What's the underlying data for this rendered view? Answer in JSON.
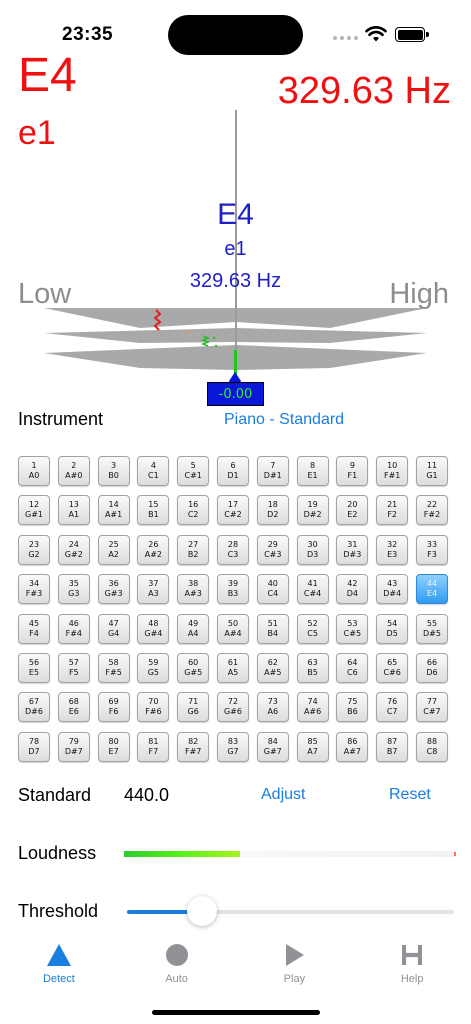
{
  "status_bar": {
    "time": "23:35"
  },
  "readout": {
    "note": "E4",
    "solfege": "e1",
    "frequency": "329.63 Hz"
  },
  "tuner": {
    "note": "E4",
    "solfege": "e1",
    "frequency": "329.63 Hz",
    "low_label": "Low",
    "high_label": "High",
    "cents": "-0.00"
  },
  "instrument": {
    "label": "Instrument",
    "value": "Piano - Standard"
  },
  "keys": [
    {
      "n": "1",
      "name": "A0"
    },
    {
      "n": "2",
      "name": "A#0"
    },
    {
      "n": "3",
      "name": "B0"
    },
    {
      "n": "4",
      "name": "C1"
    },
    {
      "n": "5",
      "name": "C#1"
    },
    {
      "n": "6",
      "name": "D1"
    },
    {
      "n": "7",
      "name": "D#1"
    },
    {
      "n": "8",
      "name": "E1"
    },
    {
      "n": "9",
      "name": "F1"
    },
    {
      "n": "10",
      "name": "F#1"
    },
    {
      "n": "11",
      "name": "G1"
    },
    {
      "n": "12",
      "name": "G#1"
    },
    {
      "n": "13",
      "name": "A1"
    },
    {
      "n": "14",
      "name": "A#1"
    },
    {
      "n": "15",
      "name": "B1"
    },
    {
      "n": "16",
      "name": "C2"
    },
    {
      "n": "17",
      "name": "C#2"
    },
    {
      "n": "18",
      "name": "D2"
    },
    {
      "n": "19",
      "name": "D#2"
    },
    {
      "n": "20",
      "name": "E2"
    },
    {
      "n": "21",
      "name": "F2"
    },
    {
      "n": "22",
      "name": "F#2"
    },
    {
      "n": "23",
      "name": "G2"
    },
    {
      "n": "24",
      "name": "G#2"
    },
    {
      "n": "25",
      "name": "A2"
    },
    {
      "n": "26",
      "name": "A#2"
    },
    {
      "n": "27",
      "name": "B2"
    },
    {
      "n": "28",
      "name": "C3"
    },
    {
      "n": "29",
      "name": "C#3"
    },
    {
      "n": "30",
      "name": "D3"
    },
    {
      "n": "31",
      "name": "D#3"
    },
    {
      "n": "32",
      "name": "E3"
    },
    {
      "n": "33",
      "name": "F3"
    },
    {
      "n": "34",
      "name": "F#3"
    },
    {
      "n": "35",
      "name": "G3"
    },
    {
      "n": "36",
      "name": "G#3"
    },
    {
      "n": "37",
      "name": "A3"
    },
    {
      "n": "38",
      "name": "A#3"
    },
    {
      "n": "39",
      "name": "B3"
    },
    {
      "n": "40",
      "name": "C4"
    },
    {
      "n": "41",
      "name": "C#4"
    },
    {
      "n": "42",
      "name": "D4"
    },
    {
      "n": "43",
      "name": "D#4"
    },
    {
      "n": "44",
      "name": "E4",
      "active": true
    },
    {
      "n": "45",
      "name": "F4"
    },
    {
      "n": "46",
      "name": "F#4"
    },
    {
      "n": "47",
      "name": "G4"
    },
    {
      "n": "48",
      "name": "G#4"
    },
    {
      "n": "49",
      "name": "A4"
    },
    {
      "n": "50",
      "name": "A#4"
    },
    {
      "n": "51",
      "name": "B4"
    },
    {
      "n": "52",
      "name": "C5"
    },
    {
      "n": "53",
      "name": "C#5"
    },
    {
      "n": "54",
      "name": "D5"
    },
    {
      "n": "55",
      "name": "D#5"
    },
    {
      "n": "56",
      "name": "E5"
    },
    {
      "n": "57",
      "name": "F5"
    },
    {
      "n": "58",
      "name": "F#5"
    },
    {
      "n": "59",
      "name": "G5"
    },
    {
      "n": "60",
      "name": "G#5"
    },
    {
      "n": "61",
      "name": "A5"
    },
    {
      "n": "62",
      "name": "A#5"
    },
    {
      "n": "63",
      "name": "B5"
    },
    {
      "n": "64",
      "name": "C6"
    },
    {
      "n": "65",
      "name": "C#6"
    },
    {
      "n": "66",
      "name": "D6"
    },
    {
      "n": "67",
      "name": "D#6"
    },
    {
      "n": "68",
      "name": "E6"
    },
    {
      "n": "69",
      "name": "F6"
    },
    {
      "n": "70",
      "name": "F#6"
    },
    {
      "n": "71",
      "name": "G6"
    },
    {
      "n": "72",
      "name": "G#6"
    },
    {
      "n": "73",
      "name": "A6"
    },
    {
      "n": "74",
      "name": "A#6"
    },
    {
      "n": "75",
      "name": "B6"
    },
    {
      "n": "76",
      "name": "C7"
    },
    {
      "n": "77",
      "name": "C#7"
    },
    {
      "n": "78",
      "name": "D7"
    },
    {
      "n": "79",
      "name": "D#7"
    },
    {
      "n": "80",
      "name": "E7"
    },
    {
      "n": "81",
      "name": "F7"
    },
    {
      "n": "82",
      "name": "F#7"
    },
    {
      "n": "83",
      "name": "G7"
    },
    {
      "n": "84",
      "name": "G#7"
    },
    {
      "n": "85",
      "name": "A7"
    },
    {
      "n": "86",
      "name": "A#7"
    },
    {
      "n": "87",
      "name": "B7"
    },
    {
      "n": "88",
      "name": "C8"
    }
  ],
  "standard": {
    "label": "Standard",
    "value": "440.0",
    "adjust_label": "Adjust",
    "reset_label": "Reset"
  },
  "loudness": {
    "label": "Loudness",
    "level": 0.35
  },
  "threshold": {
    "label": "Threshold",
    "value": 0.23
  },
  "tabs": [
    {
      "label": "Detect",
      "icon": "triangle-icon",
      "active": true
    },
    {
      "label": "Auto",
      "icon": "circle-icon"
    },
    {
      "label": "Play",
      "icon": "play-icon"
    },
    {
      "label": "Help",
      "icon": "help-h-icon"
    }
  ],
  "colors": {
    "accent": "#1a7de0",
    "readout": "#ee1111",
    "tuner_text": "#1e1ec8",
    "cents_box": "#0a16d8",
    "in_tune": "#1ec81e"
  }
}
